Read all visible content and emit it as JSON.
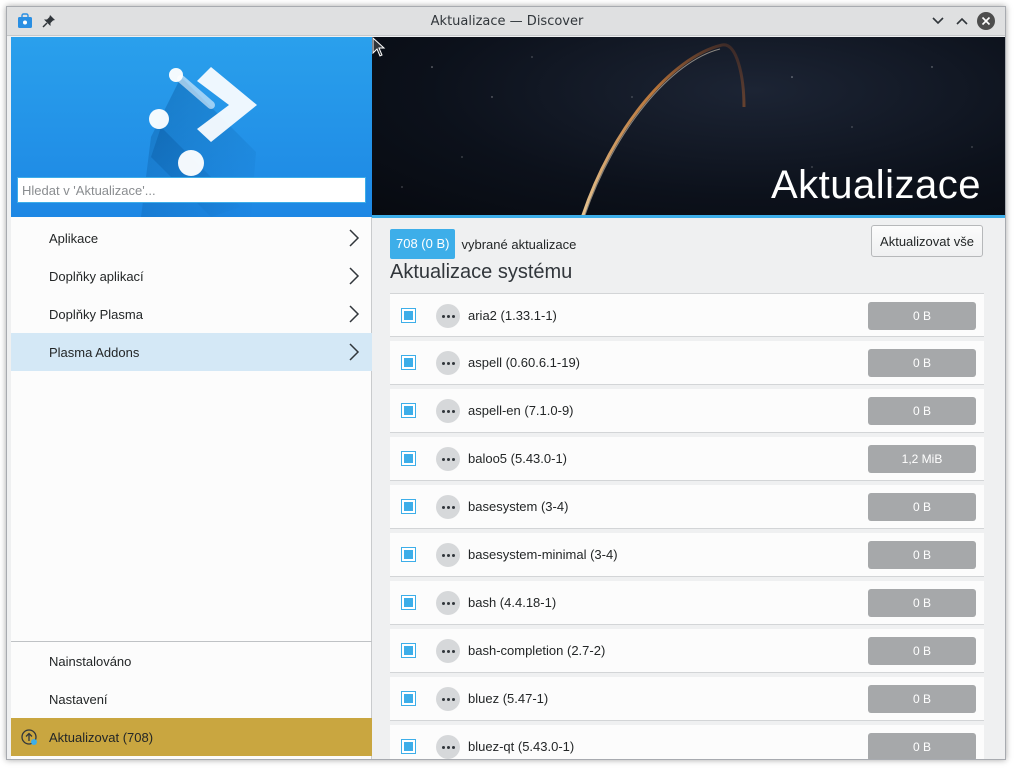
{
  "window": {
    "title": "Aktualizace — Discover"
  },
  "search": {
    "placeholder": "Hledat v 'Aktualizace'..."
  },
  "sidebar": {
    "items": [
      {
        "label": "Aplikace"
      },
      {
        "label": "Doplňky aplikací"
      },
      {
        "label": "Doplňky Plasma"
      },
      {
        "label": "Plasma Addons"
      }
    ],
    "bottom": {
      "installed": "Nainstalováno",
      "settings": "Nastavení",
      "updates": "Aktualizovat (708)"
    }
  },
  "main": {
    "banner_title": "Aktualizace",
    "selected_count": "708 (0 B)",
    "selected_text": "vybrané aktualizace",
    "update_all": "Aktualizovat vše",
    "section_title": "Aktualizace systému",
    "updates": [
      {
        "name": "aria2 (1.33.1-1)",
        "size": "0 B",
        "checked": true
      },
      {
        "name": "aspell (0.60.6.1-19)",
        "size": "0 B",
        "checked": true
      },
      {
        "name": "aspell-en (7.1.0-9)",
        "size": "0 B",
        "checked": true
      },
      {
        "name": "baloo5 (5.43.0-1)",
        "size": "1,2 MiB",
        "checked": true
      },
      {
        "name": "basesystem (3-4)",
        "size": "0 B",
        "checked": true
      },
      {
        "name": "basesystem-minimal (3-4)",
        "size": "0 B",
        "checked": true
      },
      {
        "name": "bash (4.4.18-1)",
        "size": "0 B",
        "checked": true
      },
      {
        "name": "bash-completion (2.7-2)",
        "size": "0 B",
        "checked": true
      },
      {
        "name": "bluez (5.47-1)",
        "size": "0 B",
        "checked": true
      },
      {
        "name": "bluez-qt (5.43.0-1)",
        "size": "0 B",
        "checked": true
      }
    ]
  },
  "colors": {
    "accent": "#3daee9",
    "header_blue": "#1d87e4",
    "updates_gold": "#c9a640",
    "active_item": "#d4e8f6",
    "size_pill": "#a6a8aa"
  }
}
